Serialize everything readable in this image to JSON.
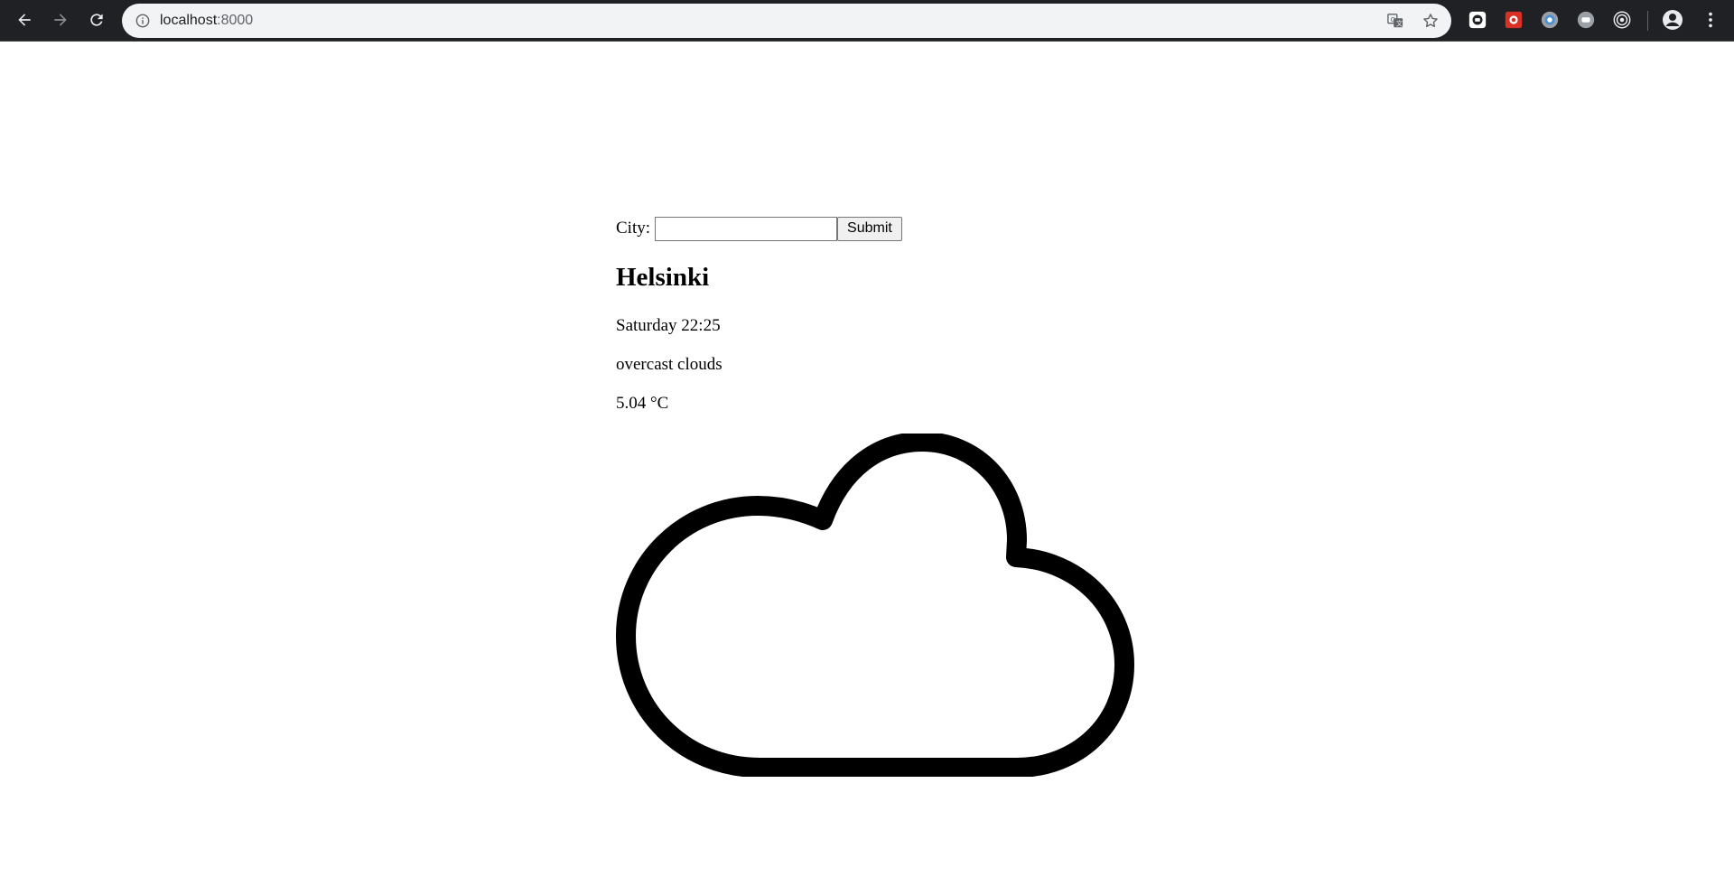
{
  "browser": {
    "url_host": "localhost",
    "url_port": ":8000",
    "icons": {
      "back": "arrow-left-icon",
      "forward": "arrow-right-icon",
      "reload": "reload-icon",
      "info": "info-icon",
      "translate": "translate-icon",
      "bookmark": "star-icon",
      "profile": "account-icon",
      "menu": "kebab-menu-icon"
    }
  },
  "form": {
    "city_label": "City:",
    "city_value": "",
    "submit_label": "Submit"
  },
  "weather": {
    "city": "Helsinki",
    "day_time": "Saturday 22:25",
    "description": "overcast clouds",
    "temperature": "5.04 °C",
    "icon": "cloud-icon"
  }
}
